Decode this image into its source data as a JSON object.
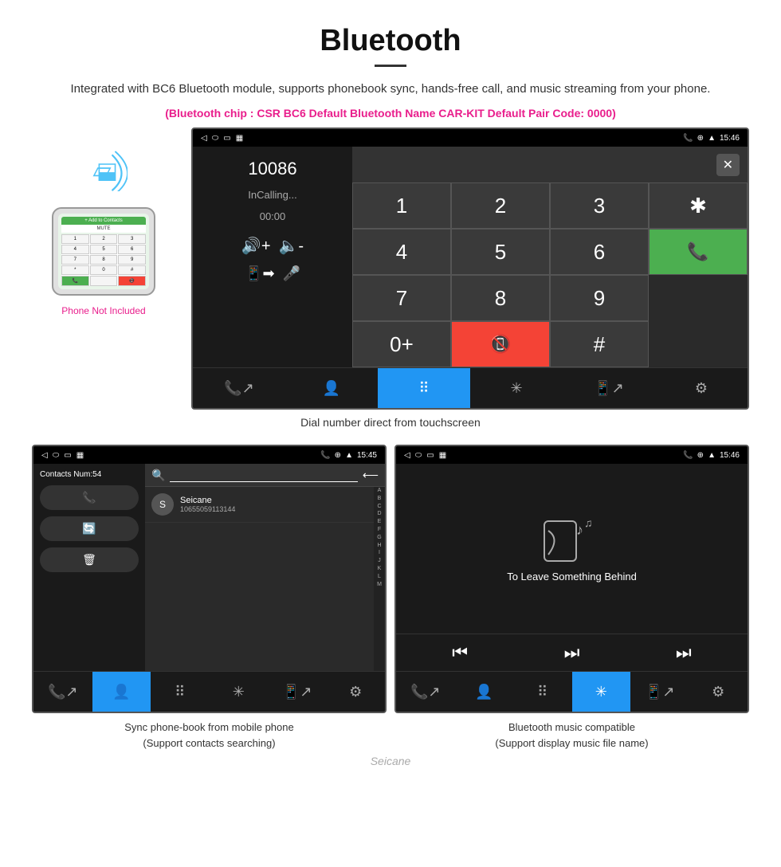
{
  "header": {
    "title": "Bluetooth",
    "description": "Integrated with BC6 Bluetooth module, supports phonebook sync, hands-free call, and music streaming from your phone.",
    "specs": "(Bluetooth chip : CSR BC6    Default Bluetooth Name CAR-KIT    Default Pair Code: 0000)"
  },
  "phone_side": {
    "not_included": "Phone Not Included"
  },
  "car_screen": {
    "status_time": "15:46",
    "call_number": "10086",
    "call_status": "InCalling...",
    "call_time": "00:00",
    "numpad_keys": [
      "1",
      "2",
      "3",
      "*",
      "4",
      "5",
      "6",
      "0+",
      "7",
      "8",
      "9",
      "#"
    ],
    "backspace": "⌫"
  },
  "main_caption": "Dial number direct from touchscreen",
  "bottom_left": {
    "contacts_num": "Contacts Num:54",
    "contact_name": "Seicane",
    "contact_number": "10655059113144",
    "status_time": "15:45",
    "alpha": [
      "A",
      "B",
      "C",
      "D",
      "E",
      "F",
      "G",
      "H",
      "I",
      "J",
      "K",
      "L",
      "M"
    ],
    "caption_line1": "Sync phone-book from mobile phone",
    "caption_line2": "(Support contacts searching)"
  },
  "bottom_right": {
    "song_title": "To Leave Something Behind",
    "status_time": "15:46",
    "caption_line1": "Bluetooth music compatible",
    "caption_line2": "(Support display music file name)"
  },
  "watermark": "Seicane"
}
